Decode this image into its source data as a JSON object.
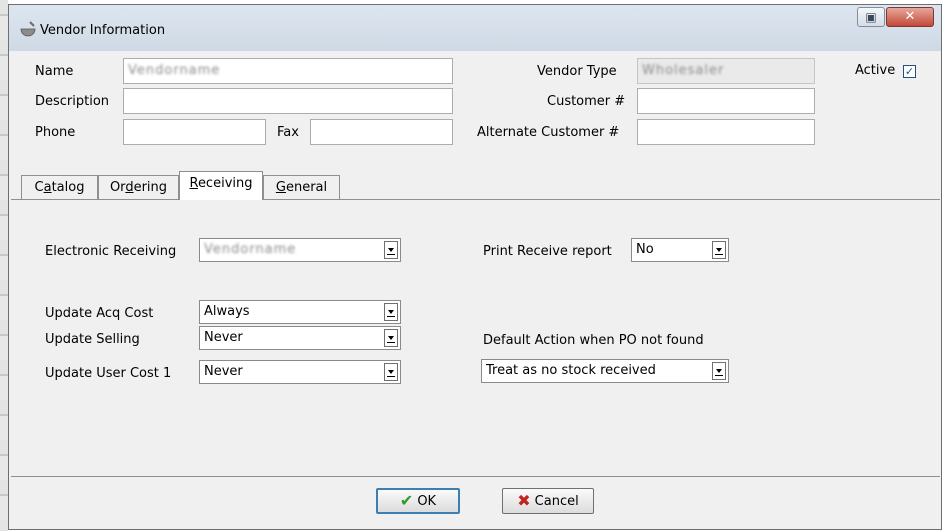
{
  "window": {
    "title": "Vendor Information"
  },
  "header": {
    "name_label": "Name",
    "name_value": "Vendorname",
    "description_label": "Description",
    "description_value": "",
    "phone_label": "Phone",
    "phone_value": "",
    "fax_label": "Fax",
    "fax_value": "",
    "vendor_type_label": "Vendor Type",
    "vendor_type_value": "Wholesaler",
    "customer_label": "Customer #",
    "customer_value": "",
    "alt_customer_label": "Alternate Customer #",
    "alt_customer_value": "",
    "active_label": "Active",
    "active_checked": true,
    "active_mark": "✓"
  },
  "tabs": [
    {
      "prefix": "C",
      "underline": "a",
      "rest": "talog"
    },
    {
      "prefix": "Or",
      "underline": "d",
      "rest": "ering"
    },
    {
      "prefix": "",
      "underline": "R",
      "rest": "eceiving"
    },
    {
      "prefix": "",
      "underline": "G",
      "rest": "eneral"
    }
  ],
  "active_tab": "Receiving",
  "receiving": {
    "electronic_label": "Electronic Receiving",
    "electronic_value": "Vendorname",
    "print_report_label": "Print Receive report",
    "print_report_value": "No",
    "acq_label": "Update Acq Cost",
    "acq_value": "Always",
    "selling_label": "Update Selling",
    "selling_value": "Never",
    "user_cost_label": "Update User Cost 1",
    "user_cost_value": "Never",
    "default_action_label": "Default Action when PO not found",
    "default_action_value": "Treat as no stock received"
  },
  "footer": {
    "ok_label": "OK",
    "cancel_label": "Cancel"
  },
  "icons": {
    "ok": "checkmark-icon",
    "cancel": "x-icon"
  },
  "colors": {
    "ok_check": "#2e9a2e",
    "cancel_x": "#c0241c",
    "titlebar": "#d6e0eb"
  }
}
